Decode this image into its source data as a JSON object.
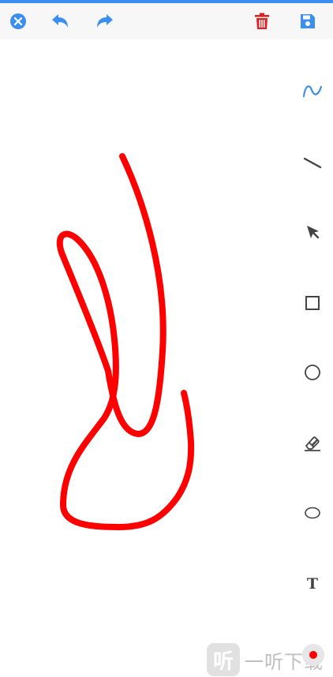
{
  "toolbar": {
    "icons": [
      "close-icon",
      "undo-icon",
      "redo-icon",
      "delete-icon",
      "save-icon"
    ]
  },
  "tools": [
    {
      "name": "freehand",
      "icon": "freehand-icon",
      "active": true
    },
    {
      "name": "line",
      "icon": "line-icon",
      "active": false
    },
    {
      "name": "arrow",
      "icon": "arrow-icon",
      "active": false
    },
    {
      "name": "rectangle",
      "icon": "rectangle-icon",
      "active": false
    },
    {
      "name": "circle",
      "icon": "circle-icon",
      "active": false
    },
    {
      "name": "eraser",
      "icon": "eraser-icon",
      "active": false
    },
    {
      "name": "ellipse",
      "icon": "ellipse-icon",
      "active": false
    },
    {
      "name": "text",
      "icon": "text-icon",
      "label": "T",
      "active": false
    }
  ],
  "canvas": {
    "stroke_color": "#ff0000"
  },
  "current_color": "#ff0000",
  "watermark": {
    "logo_text": "听",
    "text": "一听下载"
  },
  "colors": {
    "accent": "#3b8ff0",
    "delete": "#e02020",
    "icon_gray": "#444444"
  }
}
